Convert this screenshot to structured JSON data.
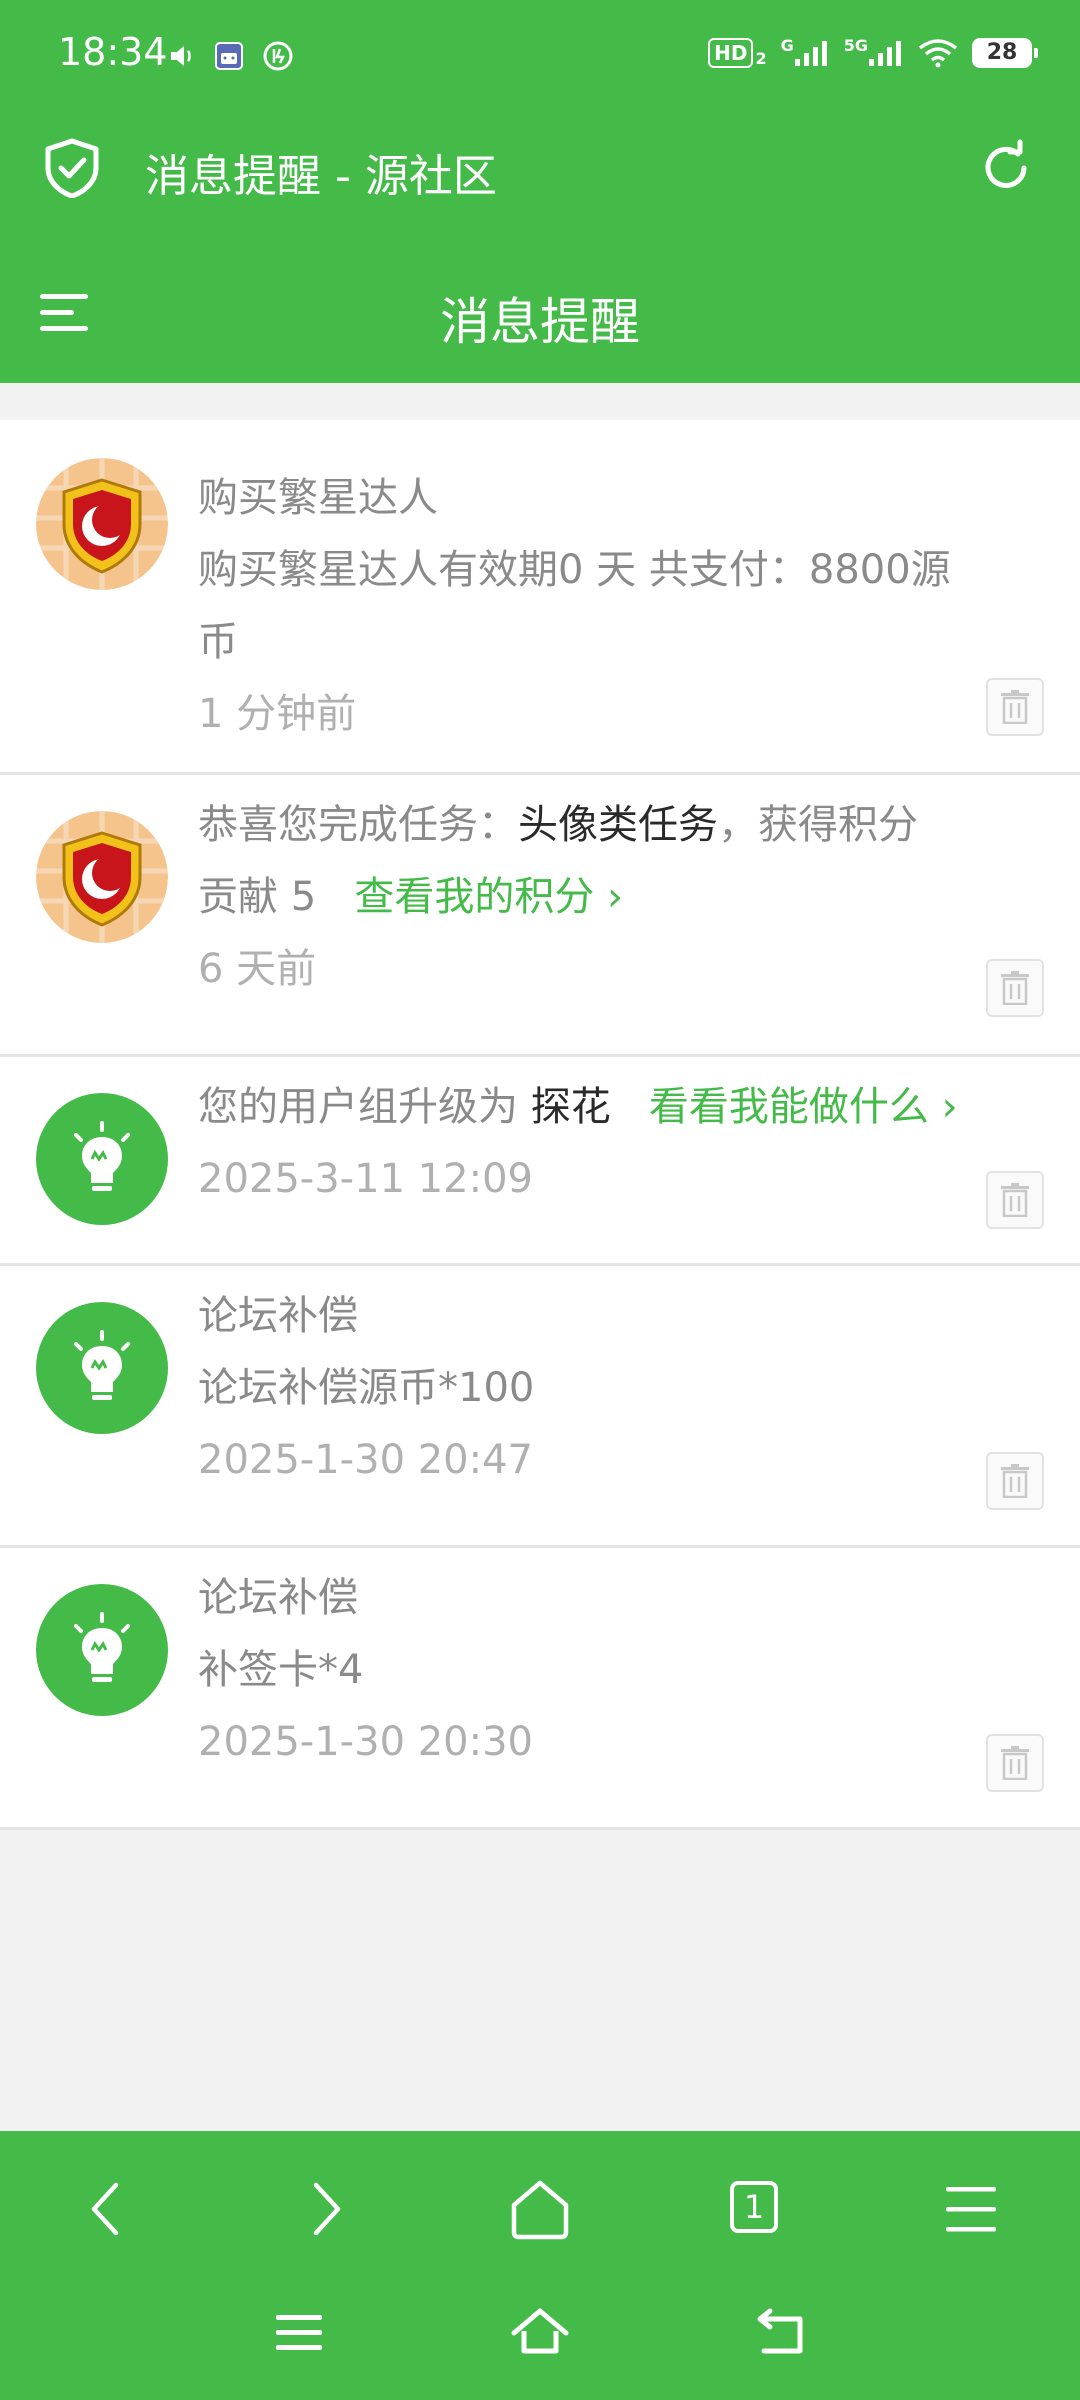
{
  "status_bar": {
    "time": "18:34",
    "hd_label": "HD",
    "hd_sub": "2",
    "net1_label": "G",
    "net2_label": "5G",
    "battery": "28"
  },
  "app_bar": {
    "title": "消息提醒 - 源社区"
  },
  "header": {
    "title": "消息提醒"
  },
  "messages": [
    {
      "avatar": "shield-moon",
      "title": "购买繁星达人",
      "content_line1": "购买繁星达人有效期0 天 共支付：8800源",
      "content_line2": "币",
      "time": "1 分钟前"
    },
    {
      "avatar": "shield-moon",
      "prefix": "恭喜您完成任务：",
      "task_name": "头像类任务",
      "suffix": "，获得积分",
      "line2_prefix": "贡献 5",
      "link": "查看我的积分 ›",
      "time": "6 天前"
    },
    {
      "avatar": "lightbulb",
      "prefix": "您的用户组升级为",
      "group_name": "探花",
      "link": "看看我能做什么 ›",
      "time": "2025-3-11 12:09"
    },
    {
      "avatar": "lightbulb",
      "title": "论坛补偿",
      "content": "论坛补偿源币*100",
      "time": "2025-1-30 20:47"
    },
    {
      "avatar": "lightbulb",
      "title": "论坛补偿",
      "content": "补签卡*4",
      "time": "2025-1-30 20:30"
    }
  ],
  "bottom_nav": {
    "tab_count": "1"
  },
  "colors": {
    "brand_green": "#44bb49",
    "background": "#f2f2f2"
  }
}
